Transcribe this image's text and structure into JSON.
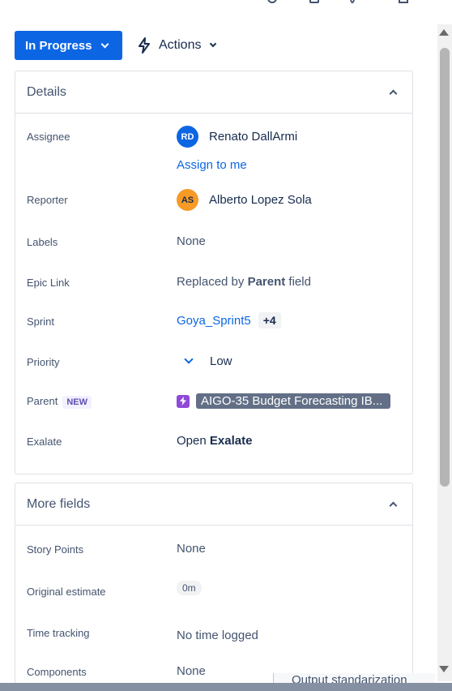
{
  "status_button": {
    "label": "In Progress"
  },
  "actions_button": {
    "label": "Actions"
  },
  "details": {
    "title": "Details",
    "assignee": {
      "label": "Assignee",
      "initials": "RD",
      "name": "Renato DallArmi",
      "avatar_color": "#0c66e4",
      "assign_link": "Assign to me"
    },
    "reporter": {
      "label": "Reporter",
      "initials": "AS",
      "name": "Alberto Lopez Sola",
      "avatar_color": "#f79a26"
    },
    "labels": {
      "label": "Labels",
      "value": "None"
    },
    "epic_link": {
      "label": "Epic Link",
      "prefix": "Replaced by",
      "bold": "Parent",
      "suffix": "field"
    },
    "sprint": {
      "label": "Sprint",
      "value": "Goya_Sprint5",
      "extra": "+4"
    },
    "priority": {
      "label": "Priority",
      "value": "Low",
      "icon": "chevron-down-icon"
    },
    "parent": {
      "label": "Parent",
      "badge": "NEW",
      "value": "AIGO-35 Budget Forecasting IB...",
      "icon": "epic-lightning-icon"
    },
    "exalate": {
      "label": "Exalate",
      "prefix": "Open",
      "bold": "Exalate"
    }
  },
  "more_fields": {
    "title": "More fields",
    "story_points": {
      "label": "Story Points",
      "value": "None"
    },
    "original_estimate": {
      "label": "Original estimate",
      "value": "0m"
    },
    "time_tracking": {
      "label": "Time tracking",
      "value": "No time logged"
    },
    "components": {
      "label": "Components",
      "value": "None"
    }
  },
  "background_text": "Output standarization"
}
